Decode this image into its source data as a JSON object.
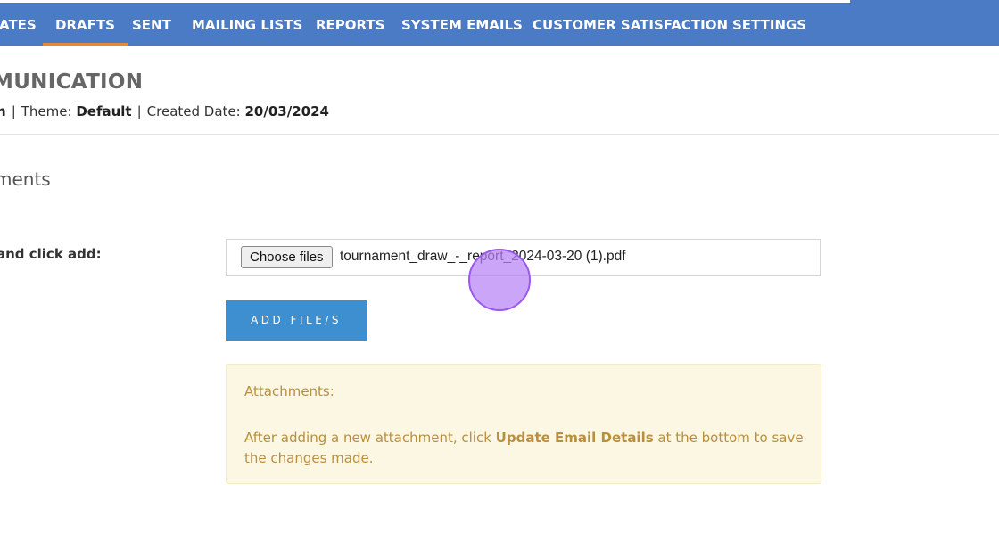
{
  "nav": {
    "items": [
      {
        "label": "ATES"
      },
      {
        "label": "DRAFTS",
        "active": true
      },
      {
        "label": "SENT"
      },
      {
        "label": "MAILING LISTS"
      },
      {
        "label": "REPORTS"
      },
      {
        "label": "SYSTEM EMAILS"
      },
      {
        "label": "CUSTOMER SATISFACTION"
      },
      {
        "label": "SETTINGS"
      }
    ],
    "background": "#4a7bc4",
    "active_underline": "#e8893a"
  },
  "page": {
    "title": "MUNICATION",
    "meta": {
      "author_value": "n",
      "theme_label": "Theme:",
      "theme_value": "Default",
      "created_label": "Created Date:",
      "created_value": "20/03/2024",
      "separator": "|"
    }
  },
  "attachments": {
    "section_title": "ments",
    "field_label": "and click add:",
    "choose_button_label": "Choose files",
    "selected_file": "tournament_draw_-_report_2024-03-20 (1).pdf",
    "add_button_label": "ADD FILE/S",
    "add_button_color": "#3d8fd0",
    "alert": {
      "heading": "Attachments:",
      "text_before": "After adding a new attachment, click ",
      "text_bold": "Update Email Details",
      "text_after": " at the bottom to save the changes made.",
      "text_color": "#b88f3e",
      "background": "#fcf7e2"
    }
  }
}
